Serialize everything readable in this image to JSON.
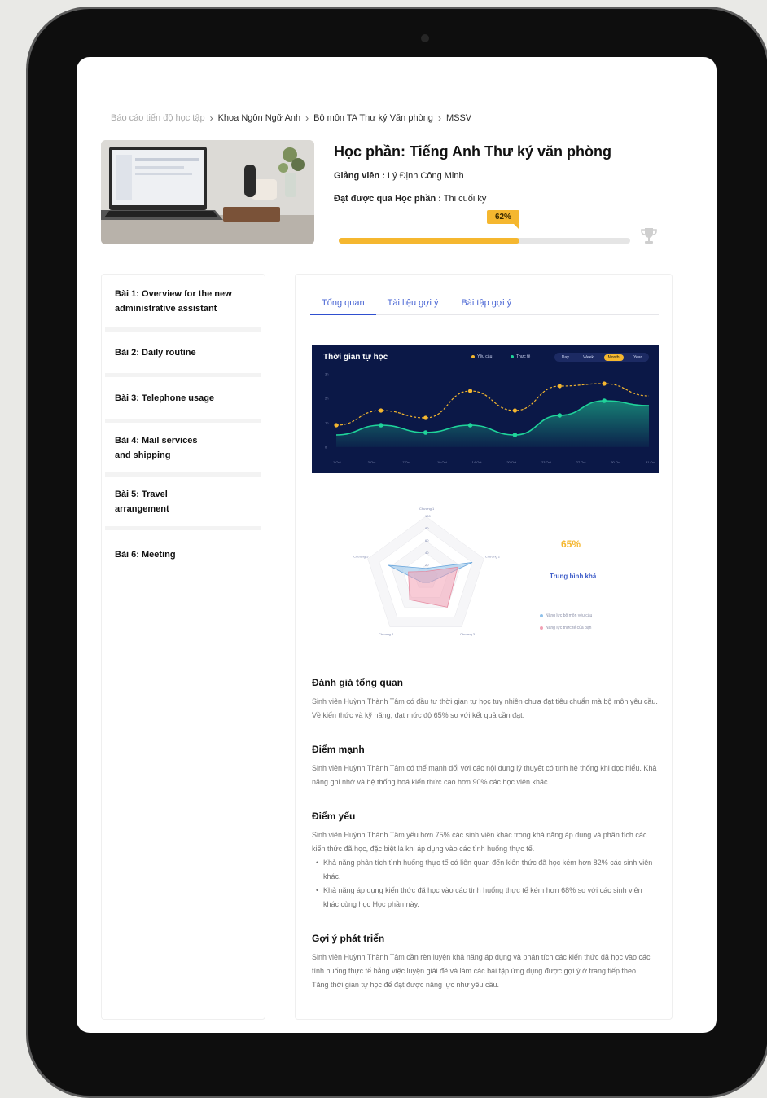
{
  "breadcrumb": {
    "items": [
      "Báo cáo tiến độ học tập",
      "Khoa Ngôn Ngữ Anh",
      "Bộ môn TA Thư ký Văn phòng",
      "MSSV"
    ]
  },
  "course": {
    "title": "Học phần: Tiếng Anh Thư ký văn phòng",
    "lecturer_label": "Giảng viên :",
    "lecturer": "Lý Định Công Minh",
    "achieve_label": "Đạt được qua Học phần :",
    "achieve_value": "Thi cuối kỳ",
    "progress_text": "62%",
    "progress": 0.62
  },
  "lessons": [
    "Bài 1: Overview for the new administrative assistant",
    "Bài 2: Daily routine",
    "Bài 3: Telephone usage",
    "Bài 4: Mail services and shipping",
    "Bài 5: Travel arrangement",
    "Bài 6: Meeting"
  ],
  "tabs": [
    "Tổng quan",
    "Tài liệu gợi ý",
    "Bài tập gợi ý"
  ],
  "chart_data": [
    {
      "type": "area",
      "title": "Thời gian tự học",
      "legend_placement": "top-right",
      "series": [
        {
          "name": "Yêu cầu",
          "color": "#f5b72f",
          "values": [
            0.9,
            1.5,
            1.2,
            2.3,
            1.5,
            2.5,
            2.6,
            2.1
          ]
        },
        {
          "name": "Thực tế",
          "color": "#1fd49a",
          "values": [
            0.5,
            0.9,
            0.6,
            0.9,
            0.5,
            1.3,
            1.9,
            1.7
          ]
        }
      ],
      "x": [
        "1 Oct",
        "3 Oct",
        "7 Oct",
        "10 Oct",
        "14 Oct",
        "20 Oct",
        "23 Oct",
        "27 Oct",
        "30 Oct",
        "31 Oct"
      ],
      "y_ticks": [
        "0",
        "1h",
        "2h",
        "3h"
      ],
      "ylim": [
        0,
        3
      ],
      "periods": [
        "Day",
        "Week",
        "Month",
        "Year"
      ],
      "selected_period": "Month",
      "grid": false
    },
    {
      "type": "radar",
      "axes": [
        "Chương 1",
        "Chương 2",
        "Chương 3",
        "Chương 4",
        "Chương 5"
      ],
      "series": [
        {
          "name": "Năng lực bộ môn yêu cầu",
          "color": "#8fc1ea",
          "values": [
            0.15,
            0.8,
            0.1,
            0.1,
            0.65
          ]
        },
        {
          "name": "Năng lực thực tế của bạn",
          "color": "#f2a1b4",
          "values": [
            0.1,
            0.55,
            0.6,
            0.45,
            0.3
          ]
        }
      ]
    }
  ],
  "gauge": {
    "percent": "65%",
    "label": "Trung bình khá"
  },
  "sections": {
    "overview_title": "Đánh giá tổng quan",
    "overview_body": "Sinh viên Huỳnh Thành Tâm có đầu tư thời gian tự học tuy nhiên chưa đạt tiêu chuẩn mà bộ môn yêu cầu. Về kiến thức và kỹ năng, đạt mức độ 65% so với kết quả cần đạt.",
    "strength_title": "Điểm mạnh",
    "strength_body": "Sinh viên Huỳnh Thành Tâm có thế mạnh đối với các nội dung lý thuyết có tính hệ thống khi đọc hiểu. Khả năng ghi nhớ và hệ thống hoá kiến thức cao hơn 90% các học viên khác.",
    "weakness_title": "Điểm yếu",
    "weakness_body": "Sinh viên Huỳnh Thành Tâm yếu hơn 75% các sinh viên khác trong khả năng áp dụng và phân tích các kiến thức đã học, đặc biệt là khi áp dụng vào các tình huống thực tế.",
    "weakness_bullets": [
      "Khả năng phân tích tình huống thực tế có liên quan đến kiến thức đã học kém hơn 82% các sinh viên khác.",
      "Khả năng áp dụng kiến thức đã học vào các tình huống thực tế kém hơn 68% so với các sinh viên khác cùng học Học phần này."
    ],
    "suggest_title": "Gợi ý phát triển",
    "suggest_body": "Sinh viên Huỳnh Thành Tâm cần rèn luyện khả năng áp dụng và phân tích các kiến thức đã học vào các tình huống thực tế bằng việc luyện giải đề và làm các bài tập ứng dụng được gợi ý ở trang tiếp theo.",
    "suggest_body2": "Tăng thời gian tự học để đạt được năng lực như yêu cầu."
  }
}
